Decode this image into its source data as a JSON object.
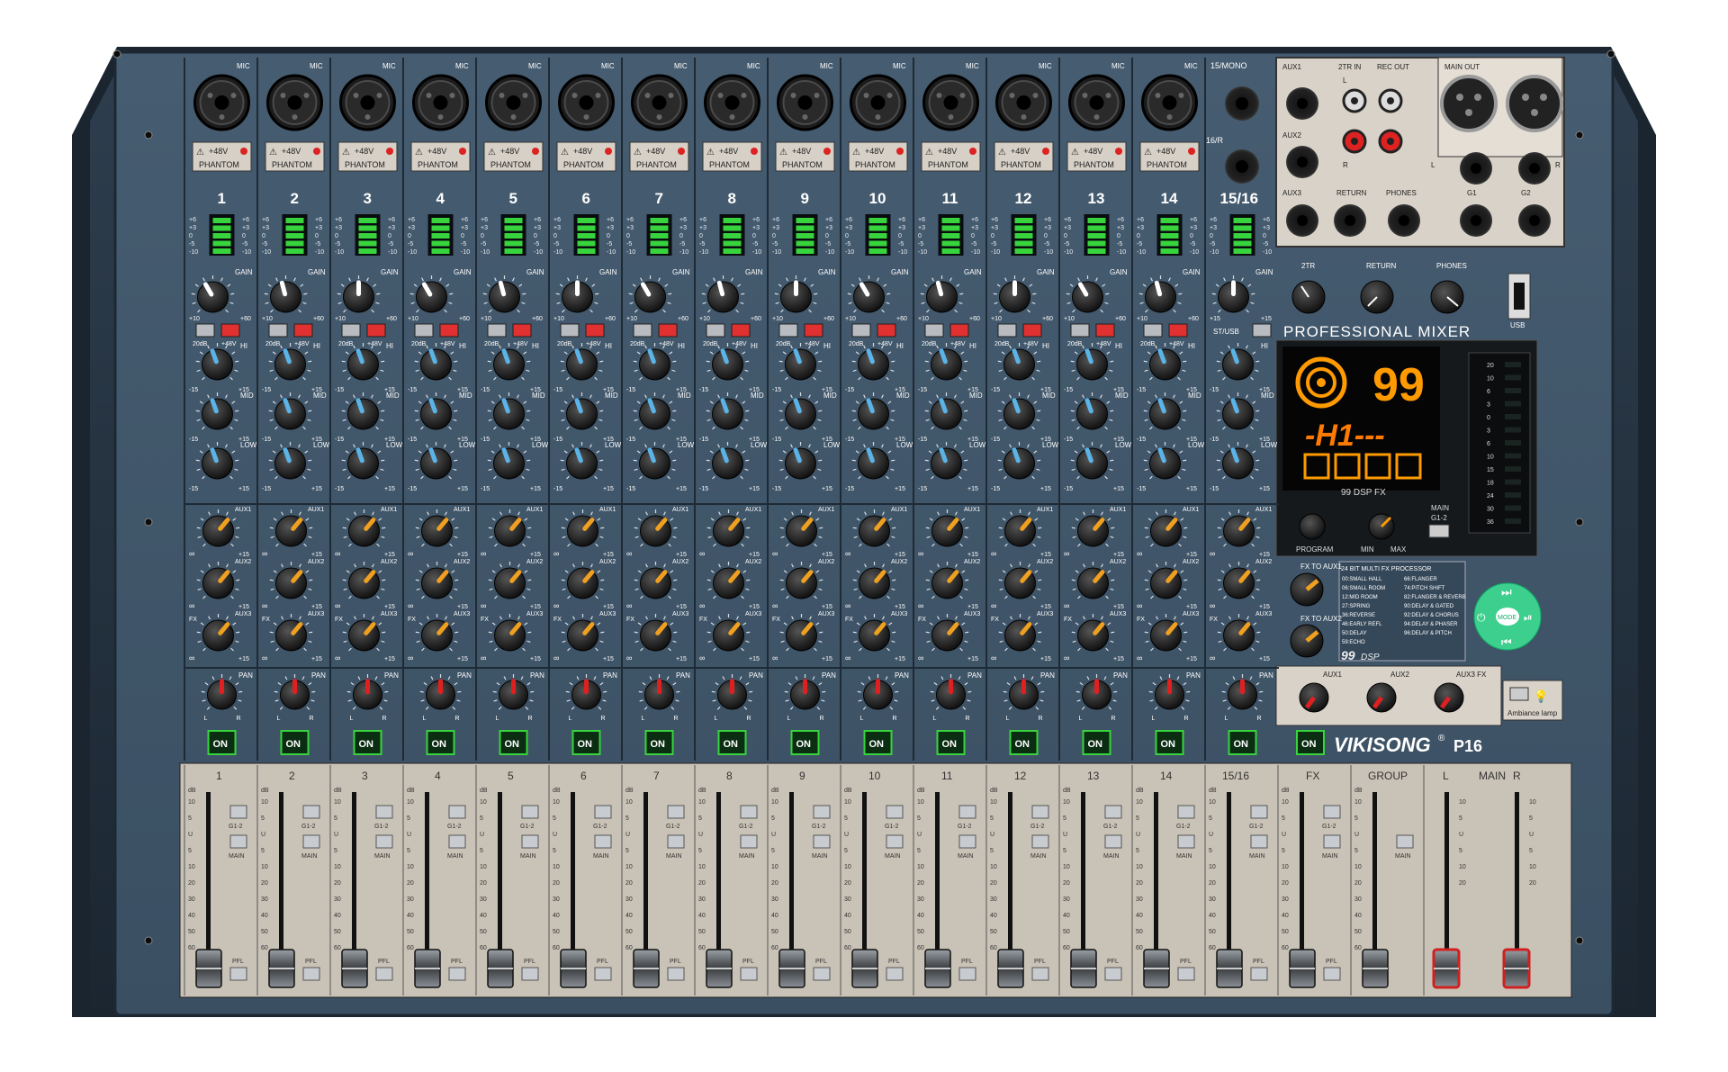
{
  "brand": {
    "name": "VIKISONG",
    "reg": "®",
    "model": "P16"
  },
  "panel_title": "PROFESSIONAL MIXER",
  "channels": [
    "1",
    "2",
    "3",
    "4",
    "5",
    "6",
    "7",
    "8",
    "9",
    "10",
    "11",
    "12",
    "13",
    "14"
  ],
  "stereo_channel": "15/16",
  "phantom": {
    "volt": "+48V",
    "label": "PHANTOM",
    "warn": "⚠"
  },
  "input_labels": {
    "mic": "MIC",
    "mono": "15/MONO",
    "right": "16/R"
  },
  "meter_scale": [
    "+6",
    "+3",
    "0",
    "-5",
    "-10"
  ],
  "knob_labels": {
    "gain": "GAIN",
    "hi": "HI",
    "mid": "MID",
    "low": "LOW",
    "aux1": "AUX1",
    "aux2": "AUX2",
    "aux3": "AUX3",
    "pan": "PAN",
    "fx": "FX",
    "min": "-15",
    "max": "+15",
    "inf": "∞",
    "l": "L",
    "r": "R",
    "gain_min": "+10",
    "gain_max": "+60"
  },
  "switch_labels": {
    "pad": "20dB",
    "phantom48": "+48V",
    "st_usb": "ST/USB"
  },
  "on_label": "ON",
  "rear_io": {
    "aux1": "AUX1",
    "aux2": "AUX2",
    "aux3": "AUX3",
    "two_tr_in": "2TR IN",
    "rec_out": "REC OUT",
    "main_out": "MAIN OUT",
    "return": "RETURN",
    "phones": "PHONES",
    "g1": "G1",
    "g2": "G2",
    "l": "L",
    "r": "R"
  },
  "master_knobs": {
    "two_tr": "2TR",
    "return": "RETURN",
    "phones": "PHONES",
    "usb": "USB"
  },
  "display": {
    "number": "99",
    "text": "-H1---",
    "fx_label": "99 DSP FX",
    "program": "PROGRAM",
    "min": "MIN",
    "max": "MAX",
    "main": "MAIN",
    "g12": "G1-2"
  },
  "main_meter_scale": [
    "20",
    "10",
    "6",
    "3",
    "0",
    "3",
    "6",
    "10",
    "15",
    "18",
    "24",
    "30",
    "36"
  ],
  "fx_section": {
    "fx_to_aux1": "FX TO AUX1",
    "fx_to_aux2": "FX TO AUX2",
    "processor_title": "24 BIT MULTI FX PROCESSOR",
    "dsp_logo_num": "99",
    "dsp_logo_txt": "DSP",
    "mode": "MODE"
  },
  "fx_presets_left": [
    "00:SMALL HALL",
    "06:SMALL ROOM",
    "12:MID ROOM",
    "27:SPRING",
    "36:REVERSE",
    "46:EARLY REFL",
    "50:DELAY",
    "59:ECHO"
  ],
  "fx_presets_right": [
    "66:FLANGER",
    "74:PITCH SHIFT",
    "82:FLANGER & REVERB",
    "90:DELAY & GATED",
    "92:DELAY & CHORUS",
    "94:DELAY & PHASER",
    "96:DELAY & PITCH"
  ],
  "fx_returns": {
    "aux1": "AUX1",
    "aux2": "AUX2",
    "aux3fx": "AUX3 FX",
    "ambiance": "Ambiance lamp"
  },
  "fader_labels": [
    "1",
    "2",
    "3",
    "4",
    "5",
    "6",
    "7",
    "8",
    "9",
    "10",
    "11",
    "12",
    "13",
    "14",
    "15/16",
    "FX"
  ],
  "group_label": "GROUP",
  "main_label": "MAIN",
  "main_lr": [
    "L",
    "R"
  ],
  "fader_scale": [
    "10",
    "5",
    "U",
    "5",
    "10",
    "20",
    "30",
    "40",
    "50",
    "60"
  ],
  "fader_buttons": {
    "db": "dB",
    "g12": "G1-2",
    "main": "MAIN",
    "pfl": "PFL"
  },
  "colors": {
    "panel": "#3d5468",
    "panel_dark": "#2c3d4d",
    "frame": "#1e2a35",
    "fader_bg": "#e8e2d8",
    "meter_green": "#37d43d",
    "knob_hi": "#5ab4e8",
    "knob_aux": "#f0a020",
    "knob_pan": "#e02020",
    "display_orange": "#ff9a00",
    "mode_green": "#3ccf8e"
  }
}
